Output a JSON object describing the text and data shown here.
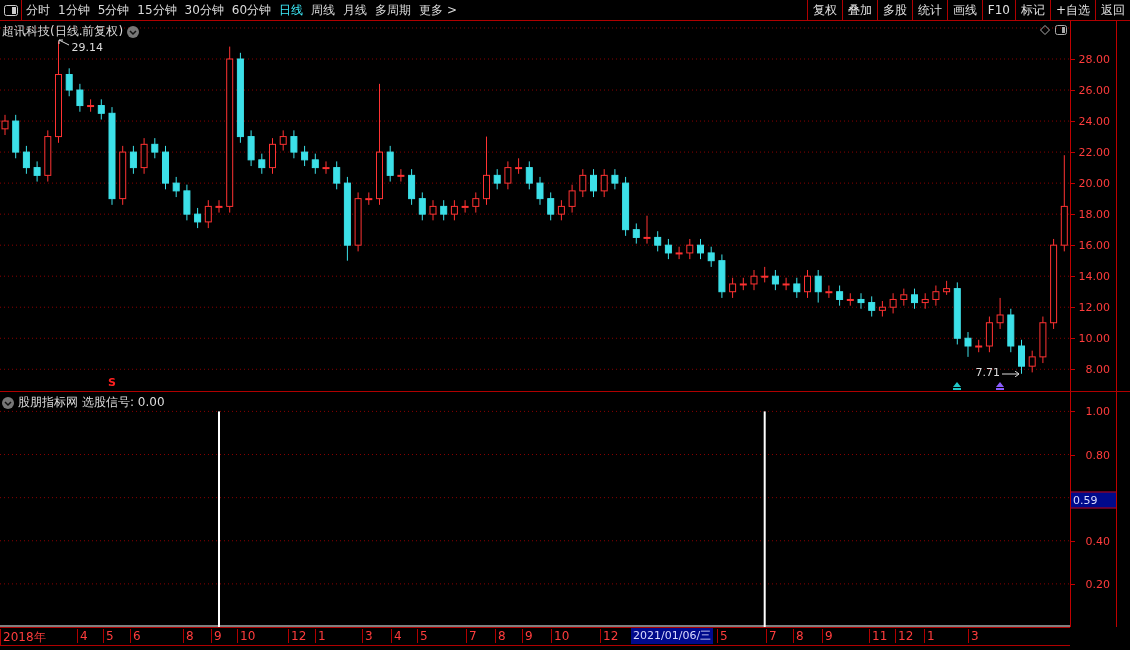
{
  "toolbar": {
    "periods": [
      {
        "label": "分时",
        "selected": false
      },
      {
        "label": "1分钟",
        "selected": false
      },
      {
        "label": "5分钟",
        "selected": false
      },
      {
        "label": "15分钟",
        "selected": false
      },
      {
        "label": "30分钟",
        "selected": false
      },
      {
        "label": "60分钟",
        "selected": false
      },
      {
        "label": "日线",
        "selected": true
      },
      {
        "label": "周线",
        "selected": false
      },
      {
        "label": "月线",
        "selected": false
      },
      {
        "label": "多周期",
        "selected": false
      }
    ],
    "more": "更多 >",
    "actions": [
      "复权",
      "叠加",
      "多股",
      "统计",
      "画线",
      "F10",
      "标记",
      "+自选",
      "返回"
    ]
  },
  "price_panel": {
    "title": "超讯科技(日线.前复权)",
    "high_label": "29.14",
    "low_label": "7.71",
    "signals": [
      {
        "kind": "sell",
        "label": "S",
        "color": "#ff2020"
      },
      {
        "kind": "up",
        "color": "#20c8c8"
      },
      {
        "kind": "up",
        "color": "#8a5cff"
      }
    ],
    "chart_data": {
      "type": "candlestick",
      "ylim": [
        6.6,
        30.45
      ],
      "yticks": [
        {
          "value": 8,
          "label": "8.00"
        },
        {
          "value": 10,
          "label": "10.00"
        },
        {
          "value": 12,
          "label": "12.00"
        },
        {
          "value": 14,
          "label": "14.00"
        },
        {
          "value": 16,
          "label": "16.00"
        },
        {
          "value": 18,
          "label": "18.00"
        },
        {
          "value": 20,
          "label": "20.00"
        },
        {
          "value": 22,
          "label": "22.00"
        },
        {
          "value": 24,
          "label": "24.00"
        },
        {
          "value": 26,
          "label": "26.00"
        },
        {
          "value": 28,
          "label": "28.00"
        }
      ],
      "grid": true,
      "ohlc": [
        [
          23.5,
          24.4,
          23.1,
          24
        ],
        [
          24,
          24.4,
          21.6,
          22
        ],
        [
          22,
          22.4,
          20.6,
          21
        ],
        [
          21,
          21.4,
          20.1,
          20.5
        ],
        [
          20.5,
          23.4,
          20.1,
          23
        ],
        [
          23,
          29.14,
          22.6,
          27
        ],
        [
          27,
          27.4,
          25.6,
          26
        ],
        [
          26,
          26.4,
          24.6,
          25
        ],
        [
          25,
          25.4,
          24.6,
          25
        ],
        [
          25,
          25.4,
          24.1,
          24.5
        ],
        [
          24.5,
          24.9,
          18.6,
          19
        ],
        [
          19,
          22.4,
          18.6,
          22
        ],
        [
          22,
          22.4,
          20.6,
          21
        ],
        [
          21,
          22.9,
          20.6,
          22.5
        ],
        [
          22.5,
          22.9,
          21.6,
          22
        ],
        [
          22,
          22.4,
          19.6,
          20
        ],
        [
          20,
          20.4,
          19.1,
          19.5
        ],
        [
          19.5,
          19.9,
          17.6,
          18
        ],
        [
          18,
          18.4,
          17.1,
          17.5
        ],
        [
          17.5,
          18.9,
          17.1,
          18.5
        ],
        [
          18.5,
          18.9,
          18.1,
          18.5
        ],
        [
          18.5,
          28.8,
          18.1,
          28
        ],
        [
          28,
          28.4,
          22.6,
          23
        ],
        [
          23,
          23.4,
          21.1,
          21.5
        ],
        [
          21.5,
          21.9,
          20.6,
          21
        ],
        [
          21,
          22.9,
          20.6,
          22.5
        ],
        [
          22.5,
          23.4,
          22.1,
          23
        ],
        [
          23,
          23.4,
          21.6,
          22
        ],
        [
          22,
          22.4,
          21.1,
          21.5
        ],
        [
          21.5,
          21.9,
          20.6,
          21
        ],
        [
          21,
          21.4,
          20.6,
          21
        ],
        [
          21,
          21.4,
          19.6,
          20
        ],
        [
          20,
          20.4,
          15,
          16
        ],
        [
          16,
          19.4,
          15.6,
          19
        ],
        [
          19,
          19.4,
          18.6,
          19
        ],
        [
          19,
          26.4,
          18.6,
          22
        ],
        [
          22,
          22.4,
          20.1,
          20.5
        ],
        [
          20.5,
          20.9,
          20.1,
          20.5
        ],
        [
          20.5,
          20.9,
          18.6,
          19
        ],
        [
          19,
          19.4,
          17.6,
          18
        ],
        [
          18,
          18.9,
          17.6,
          18.5
        ],
        [
          18.5,
          18.9,
          17.6,
          18
        ],
        [
          18,
          18.9,
          17.6,
          18.5
        ],
        [
          18.5,
          18.9,
          18.1,
          18.5
        ],
        [
          18.5,
          19.4,
          18.1,
          19
        ],
        [
          19,
          23,
          18.6,
          20.5
        ],
        [
          20.5,
          20.9,
          19.6,
          20
        ],
        [
          20,
          21.4,
          19.6,
          21
        ],
        [
          21,
          21.6,
          20.6,
          21
        ],
        [
          21,
          21.4,
          19.6,
          20
        ],
        [
          20,
          20.4,
          18.6,
          19
        ],
        [
          19,
          19.4,
          17.6,
          18
        ],
        [
          18,
          18.9,
          17.6,
          18.5
        ],
        [
          18.5,
          19.9,
          18.1,
          19.5
        ],
        [
          19.5,
          20.9,
          19.1,
          20.5
        ],
        [
          20.5,
          20.9,
          19.1,
          19.5
        ],
        [
          19.5,
          20.9,
          19.1,
          20.5
        ],
        [
          20.5,
          20.9,
          19.6,
          20
        ],
        [
          20,
          20.4,
          16.6,
          17
        ],
        [
          17,
          17.4,
          16.1,
          16.5
        ],
        [
          16.5,
          17.9,
          16.1,
          16.5
        ],
        [
          16.5,
          16.9,
          15.6,
          16
        ],
        [
          16,
          16.4,
          15.1,
          15.5
        ],
        [
          15.5,
          15.9,
          15.1,
          15.5
        ],
        [
          15.5,
          16.4,
          15.1,
          16
        ],
        [
          16,
          16.4,
          15.1,
          15.5
        ],
        [
          15.5,
          15.9,
          14.6,
          15
        ],
        [
          15,
          15.4,
          12.6,
          13
        ],
        [
          13,
          13.9,
          12.6,
          13.5
        ],
        [
          13.5,
          13.9,
          13.1,
          13.5
        ],
        [
          13.5,
          14.4,
          13.1,
          14
        ],
        [
          14,
          14.6,
          13.6,
          14
        ],
        [
          14,
          14.4,
          13.1,
          13.5
        ],
        [
          13.5,
          13.9,
          13.1,
          13.5
        ],
        [
          13.5,
          13.9,
          12.6,
          13
        ],
        [
          13,
          14.4,
          12.6,
          14
        ],
        [
          14,
          14.4,
          12.3,
          13
        ],
        [
          13,
          13.4,
          12.6,
          13
        ],
        [
          13,
          13.4,
          12.1,
          12.5
        ],
        [
          12.5,
          12.9,
          12.1,
          12.5
        ],
        [
          12.5,
          12.9,
          11.9,
          12.3
        ],
        [
          12.3,
          12.7,
          11.4,
          11.8
        ],
        [
          11.8,
          12.4,
          11.4,
          12
        ],
        [
          12,
          12.9,
          11.6,
          12.5
        ],
        [
          12.5,
          13.2,
          12.1,
          12.8
        ],
        [
          12.8,
          13.2,
          11.9,
          12.3
        ],
        [
          12.3,
          12.9,
          11.9,
          12.5
        ],
        [
          12.5,
          13.4,
          12.1,
          13
        ],
        [
          13,
          13.7,
          12.8,
          13.2
        ],
        [
          13.2,
          13.6,
          9.6,
          10
        ],
        [
          10,
          10.4,
          8.8,
          9.5
        ],
        [
          9.5,
          9.9,
          9.1,
          9.5
        ],
        [
          9.5,
          11.4,
          9.1,
          11
        ],
        [
          11,
          12.6,
          10.6,
          11.5
        ],
        [
          11.5,
          11.9,
          9.1,
          9.5
        ],
        [
          9.5,
          9.9,
          7.71,
          8.2
        ],
        [
          8.2,
          9.2,
          7.8,
          8.8
        ],
        [
          8.8,
          11.4,
          8.4,
          11
        ],
        [
          11,
          16.4,
          10.6,
          16
        ],
        [
          16,
          21.8,
          15.6,
          18.5
        ]
      ]
    }
  },
  "indicator_panel": {
    "name": "股朋指标网",
    "reading": "选股信号: 0.00",
    "cursor_value": "0.59",
    "chart_data": {
      "type": "bar",
      "grid": true,
      "ylim": [
        0,
        1.09
      ],
      "yticks": [
        {
          "value": 0.2,
          "label": "0.20"
        },
        {
          "value": 0.4,
          "label": "0.40"
        },
        {
          "value": 0.8,
          "label": "0.80"
        },
        {
          "value": 1,
          "label": "1.00"
        }
      ],
      "series": [
        {
          "color": "#ffffff",
          "values": [
            0,
            0,
            0,
            0,
            0,
            0,
            0,
            0,
            0,
            0,
            0,
            0,
            0,
            0,
            0,
            0,
            0,
            0,
            0,
            0,
            1,
            0,
            0,
            0,
            0,
            0,
            0,
            0,
            0,
            0,
            0,
            0,
            0,
            0,
            0,
            0,
            0,
            0,
            0,
            0,
            0,
            0,
            0,
            0,
            0,
            0,
            0,
            0,
            0,
            0,
            0,
            0,
            0,
            0,
            0,
            0,
            0,
            0,
            0,
            0,
            0,
            0,
            0,
            0,
            0,
            0,
            0,
            0,
            0,
            0,
            0,
            1,
            0,
            0,
            0,
            0,
            0,
            0,
            0,
            0,
            0,
            0,
            0,
            0,
            0,
            0,
            0,
            0,
            0,
            0,
            0,
            0,
            0,
            0,
            0,
            0,
            0,
            0,
            0,
            0
          ]
        }
      ]
    }
  },
  "time_axis": {
    "labels": [
      "2018年",
      "4",
      "5",
      "6",
      "8",
      "9",
      "10",
      "12",
      "1",
      "3",
      "4",
      "5",
      "7",
      "8",
      "9",
      "10",
      "12",
      "5",
      "7",
      "8",
      "9",
      "11",
      "12",
      "1",
      "3"
    ],
    "cursor": "2021/01/06/三"
  }
}
